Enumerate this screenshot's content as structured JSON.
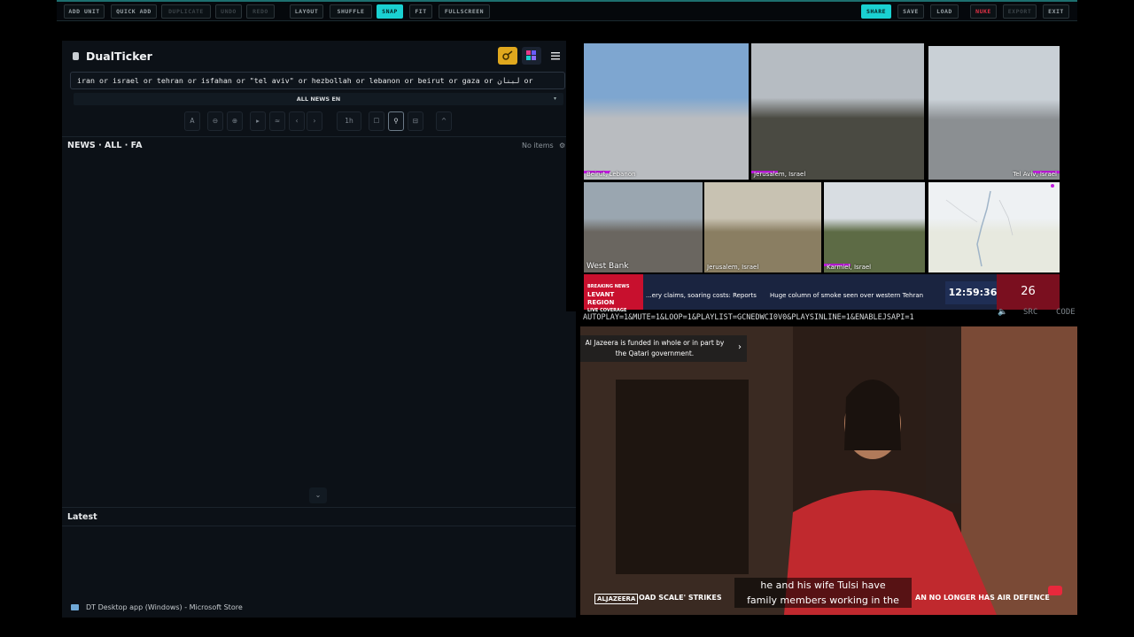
{
  "toolbar": {
    "left": [
      {
        "label": "ADD UNIT",
        "state": "normal"
      },
      {
        "label": "QUICK ADD",
        "state": "normal"
      },
      {
        "label": "DUPLICATE",
        "state": "disabled"
      },
      {
        "label": "UNDO",
        "state": "disabled"
      },
      {
        "label": "REDO",
        "state": "disabled"
      },
      {
        "label": "LAYOUT",
        "state": "normal"
      },
      {
        "label": "SHUFFLE",
        "state": "normal"
      },
      {
        "label": "SNAP",
        "state": "active"
      },
      {
        "label": "FIT",
        "state": "normal"
      },
      {
        "label": "FULLSCREEN",
        "state": "normal"
      }
    ],
    "right": [
      {
        "label": "SHARE",
        "state": "active"
      },
      {
        "label": "SAVE",
        "state": "normal"
      },
      {
        "label": "LOAD",
        "state": "normal"
      },
      {
        "label": "NUKE",
        "state": "danger"
      },
      {
        "label": "EXPORT",
        "state": "disabled"
      },
      {
        "label": "EXIT",
        "state": "normal"
      }
    ]
  },
  "news_panel": {
    "app_name": "DualTicker",
    "query": "iran or israel or tehran or isfahan or \"tel aviv\" or hezbollah or lebanon or beirut or gaza or لبنان or",
    "scope": "ALL NEWS EN",
    "controls": [
      "A",
      "⊖",
      "⊕",
      "▸",
      "≈",
      "‹",
      "›",
      "1h",
      "☐",
      "⚲",
      "⊟",
      "^"
    ],
    "section_title": "NEWS · ALL · FA",
    "items_status": "No items",
    "latest_title": "Latest",
    "store_link": "DT Desktop app (Windows) - Microsoft Store"
  },
  "webcams": [
    {
      "label": "Beirut, Lebanon",
      "sky": "#7ea6d0",
      "ground": "#b9bcc0"
    },
    {
      "label": "Jerusalem, Israel",
      "sky": "#b6bcc2",
      "ground": "#4a4a42"
    },
    {
      "label": "Tel Aviv, Israel",
      "sky": "#c9d0d6",
      "ground": "#8b8f92"
    },
    {
      "label": "West Bank",
      "sky": "#9aa6b0",
      "ground": "#6a6660"
    },
    {
      "label": "Jerusalem, Israel",
      "sky": "#c8c2b2",
      "ground": "#8a7e62"
    },
    {
      "label": "Karmiel, Israel",
      "sky": "#d8dde2",
      "ground": "#5d6b45"
    },
    {
      "label": "",
      "sky": "#eef1f3",
      "ground": "#e7e9df"
    }
  ],
  "ticker": {
    "badge_top": "BREAKING NEWS",
    "badge_main": "LEVANT REGION",
    "badge_sub": "LIVE COVERAGE",
    "headline_1": "...ery claims, soaring costs: Reports",
    "headline_2": "Huge column of smoke seen over western Tehran",
    "time": "12:59:36",
    "day": "26"
  },
  "embed_url": "AUTOPLAY=1&MUTE=1&LOOP=1&PLAYLIST=GCNEDWCI0V0&PLAYSINLINE=1&ENABLEJSAPI=1",
  "embed_src_label": "SRC",
  "embed_code_label": "CODE",
  "video": {
    "funding_notice": "Al Jazeera is funded in whole or in part by the Qatari government.",
    "subtitle_line_1": "he and his wife Tulsi have",
    "subtitle_line_2": "family members working in the",
    "channel": "ALJAZEERA",
    "ticker_left": "OAD SCALE' STRIKES",
    "ticker_right": "AN NO LONGER HAS AIR DEFENCE"
  },
  "colors": {
    "accent": "#1ad1d1",
    "danger": "#e23246",
    "panel": "#0c1117"
  }
}
